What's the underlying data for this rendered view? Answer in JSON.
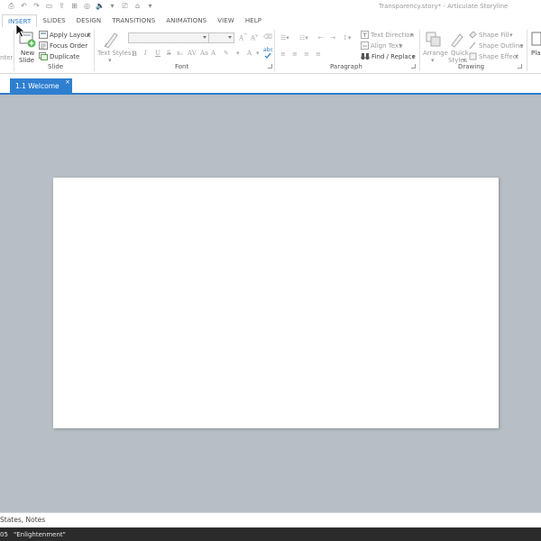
{
  "window": {
    "title": "Transparency.story* - Articulate Storyline"
  },
  "ribbon_tabs": [
    {
      "label": "INSERT",
      "active": true
    },
    {
      "label": "SLIDES",
      "active": false
    },
    {
      "label": "DESIGN",
      "active": false
    },
    {
      "label": "TRANSITIONS",
      "active": false
    },
    {
      "label": "ANIMATIONS",
      "active": false
    },
    {
      "label": "VIEW",
      "active": false
    },
    {
      "label": "HELP",
      "active": false
    }
  ],
  "ribbon": {
    "cut_off_left": "nter",
    "slide_group": {
      "new_slide_line1": "New",
      "new_slide_line2": "Slide",
      "apply_layout": "Apply Layout",
      "focus_order": "Focus Order",
      "duplicate": "Duplicate",
      "label": "Slide"
    },
    "font_group": {
      "text_styles": "Text Styles",
      "label": "Font",
      "bold": "B",
      "italic": "I",
      "underline": "U",
      "strike": "S",
      "abc": "abc"
    },
    "paragraph_group": {
      "text_direction": "Text Direction",
      "align_text": "Align Text",
      "find_replace": "Find / Replace",
      "label": "Paragraph"
    },
    "drawing_group": {
      "arrange": "Arrange",
      "quick_styles_line1": "Quick",
      "quick_styles_line2": "Styles",
      "shape_fill": "Shape Fill",
      "shape_outline": "Shape Outline",
      "shape_effect": "Shape Effect",
      "label": "Drawing"
    },
    "cut_off_right": "Pla"
  },
  "document_tab": {
    "label": "1.1 Welcome",
    "close": "×"
  },
  "bottom_panel": {
    "label": "States, Notes"
  },
  "status_bar": {
    "left": "05",
    "theme": "\"Enlightenment\""
  },
  "colors": {
    "accent": "#2f7fd0",
    "stage": "#b7bec5",
    "status_bg": "#2b2b2b"
  }
}
